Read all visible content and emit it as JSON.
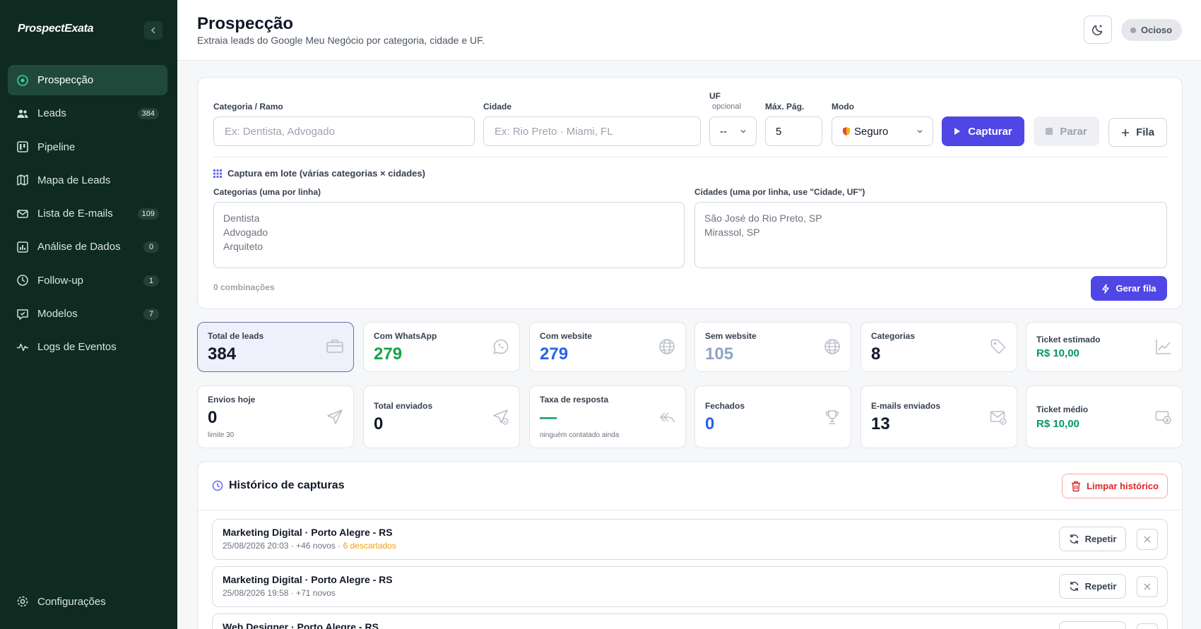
{
  "app": {
    "brand": "ProspectExata"
  },
  "sidebar": {
    "items": [
      {
        "label": "Prospecção",
        "icon": "target-icon",
        "badge": ""
      },
      {
        "label": "Leads",
        "icon": "users-icon",
        "badge": "384"
      },
      {
        "label": "Pipeline",
        "icon": "kanban-icon",
        "badge": ""
      },
      {
        "label": "Mapa de Leads",
        "icon": "map-icon",
        "badge": ""
      },
      {
        "label": "Lista de E-mails",
        "icon": "mail-icon",
        "badge": "109"
      },
      {
        "label": "Análise de Dados",
        "icon": "bar-chart-icon",
        "badge": "0"
      },
      {
        "label": "Follow-up",
        "icon": "clock-icon",
        "badge": "1"
      },
      {
        "label": "Modelos",
        "icon": "template-icon",
        "badge": "7"
      },
      {
        "label": "Logs de Eventos",
        "icon": "activity-icon",
        "badge": ""
      }
    ],
    "settings_label": "Configurações"
  },
  "header": {
    "title": "Prospecção",
    "subtitle": "Extraia leads do Google Meu Negócio por categoria, cidade e UF.",
    "status": "Ocioso"
  },
  "capture": {
    "category_label": "Categoria / Ramo",
    "category_placeholder": "Ex: Dentista, Advogado",
    "city_label": "Cidade",
    "city_placeholder": "Ex: Rio Preto · Miami, FL",
    "uf_label": "UF",
    "uf_optional": "opcional",
    "uf_value": "--",
    "max_pages_label": "Máx. Pág.",
    "max_pages_value": "5",
    "mode_label": "Modo",
    "mode_value": "Seguro",
    "capture_button": "Capturar",
    "stop_button": "Parar",
    "queue_button": "Fila",
    "batch_title": "Captura em lote (várias categorias × cidades)",
    "categories_label": "Categorias (uma por linha)",
    "categories_placeholder": "Dentista\nAdvogado\nArquiteto",
    "cities_label": "Cidades (uma por linha, use \"Cidade, UF\")",
    "cities_placeholder": "São José do Rio Preto, SP\nMirassol, SP",
    "combinations": "0 combinações",
    "generate_queue_button": "Gerar fila"
  },
  "colors": {
    "whatsapp": "#16a34a",
    "website": "#2563eb",
    "no_website": "#8fa4c9",
    "fechados": "#2563eb",
    "money": "#059669",
    "accent": "#4f46e5"
  },
  "stats_row1": [
    {
      "label": "Total de leads",
      "value": "384",
      "icon": "briefcase-icon",
      "note": ""
    },
    {
      "label": "Com WhatsApp",
      "value": "279",
      "icon": "whatsapp-icon",
      "note": ""
    },
    {
      "label": "Com website",
      "value": "279",
      "icon": "globe-icon",
      "note": ""
    },
    {
      "label": "Sem website",
      "value": "105",
      "icon": "globe-icon",
      "note": ""
    },
    {
      "label": "Categorias",
      "value": "8",
      "icon": "tag-icon",
      "note": ""
    },
    {
      "label": "Ticket estimado",
      "value": "R$ 10,00",
      "icon": "trending-up-icon",
      "note": ""
    }
  ],
  "stats_row2": [
    {
      "label": "Envios hoje",
      "value": "0",
      "icon": "send-icon",
      "note": "limite 30"
    },
    {
      "label": "Total enviados",
      "value": "0",
      "icon": "send-check-icon",
      "note": ""
    },
    {
      "label": "Taxa de resposta",
      "value": "—",
      "icon": "reply-icon",
      "note": "ninguém contatado ainda"
    },
    {
      "label": "Fechados",
      "value": "0",
      "icon": "trophy-icon",
      "note": ""
    },
    {
      "label": "E-mails enviados",
      "value": "13",
      "icon": "mail-check-icon",
      "note": ""
    },
    {
      "label": "Ticket médio",
      "value": "R$ 10,00",
      "icon": "money-icon",
      "note": ""
    }
  ],
  "history": {
    "title": "Histórico de capturas",
    "clear_button": "Limpar histórico",
    "repeat_label": "Repetir",
    "rows": [
      {
        "title": "Marketing Digital · Porto Alegre - RS",
        "meta": "25/08/2026 20:03 · +46 novos · ",
        "discarded": "6 descartados"
      },
      {
        "title": "Marketing Digital · Porto Alegre - RS",
        "meta": "25/08/2026 19:58 · +71 novos",
        "discarded": ""
      },
      {
        "title": "Web Designer · Porto Alegre - RS",
        "meta": "",
        "discarded": ""
      }
    ]
  }
}
